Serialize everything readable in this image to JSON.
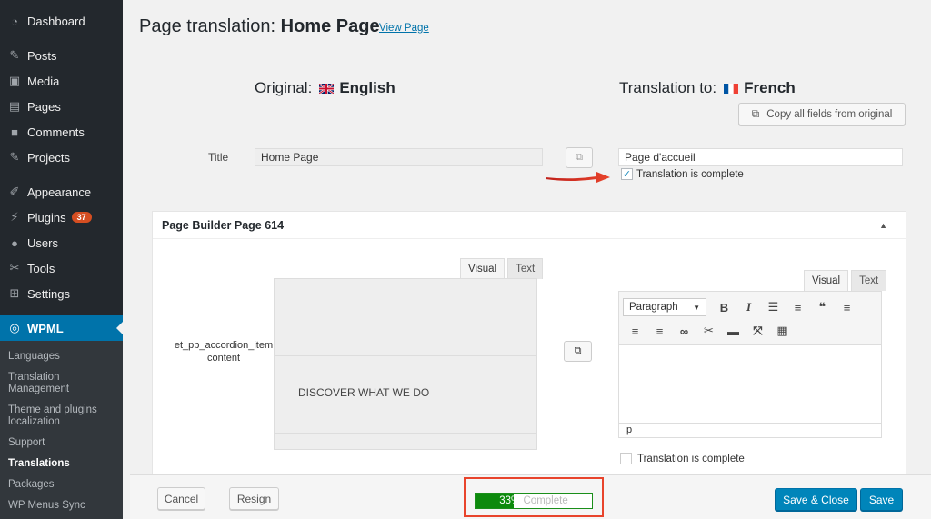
{
  "sidebar": {
    "items": [
      {
        "label": "Dashboard",
        "icon": "dashboard-icon"
      },
      {
        "label": "Posts",
        "icon": "pin-icon"
      },
      {
        "label": "Media",
        "icon": "media-icon"
      },
      {
        "label": "Pages",
        "icon": "pages-icon"
      },
      {
        "label": "Comments",
        "icon": "comment-icon"
      },
      {
        "label": "Projects",
        "icon": "pin-icon"
      },
      {
        "label": "Appearance",
        "icon": "brush-icon"
      },
      {
        "label": "Plugins",
        "icon": "plugin-icon",
        "badge": "37"
      },
      {
        "label": "Users",
        "icon": "user-icon"
      },
      {
        "label": "Tools",
        "icon": "wrench-icon"
      },
      {
        "label": "Settings",
        "icon": "settings-icon"
      },
      {
        "label": "WPML",
        "icon": "wpml-icon"
      }
    ],
    "submenu": [
      "Languages",
      "Translation Management",
      "Theme and plugins localization",
      "Support",
      "Translations",
      "Packages",
      "WP Menus Sync"
    ],
    "current_submenu": "Translations"
  },
  "header": {
    "title_prefix": "Page translation:",
    "title_page": "Home Page",
    "view_link": "View Page"
  },
  "languages": {
    "original_label": "Original:",
    "original_lang": "English",
    "translation_label": "Translation to:",
    "translation_lang": "French",
    "copy_all_label": "Copy all fields from original"
  },
  "title_field": {
    "label": "Title",
    "original": "Home Page",
    "translation": "Page d'accueil",
    "complete_label": "Translation is complete",
    "complete_checked": true
  },
  "panel": {
    "title": "Page Builder Page 614",
    "field_label": "et_pb_accordion_item content",
    "orig_tabs": [
      "Visual",
      "Text"
    ],
    "orig_content": "DISCOVER WHAT WE DO",
    "trans_tabs": [
      "Visual",
      "Text"
    ],
    "format_select": "Paragraph",
    "status_path": "p",
    "complete_label": "Translation is complete",
    "complete_checked": false
  },
  "footer": {
    "cancel": "Cancel",
    "resign": "Resign",
    "progress_percent": "33%",
    "progress_suffix": " Complete",
    "progress_value": 0.33,
    "save_close": "Save & Close",
    "save": "Save"
  },
  "colors": {
    "sidebar_bg": "#23282d",
    "accent": "#0073aa",
    "progress_fill": "#0d8a0d",
    "highlight": "#e8442c"
  }
}
